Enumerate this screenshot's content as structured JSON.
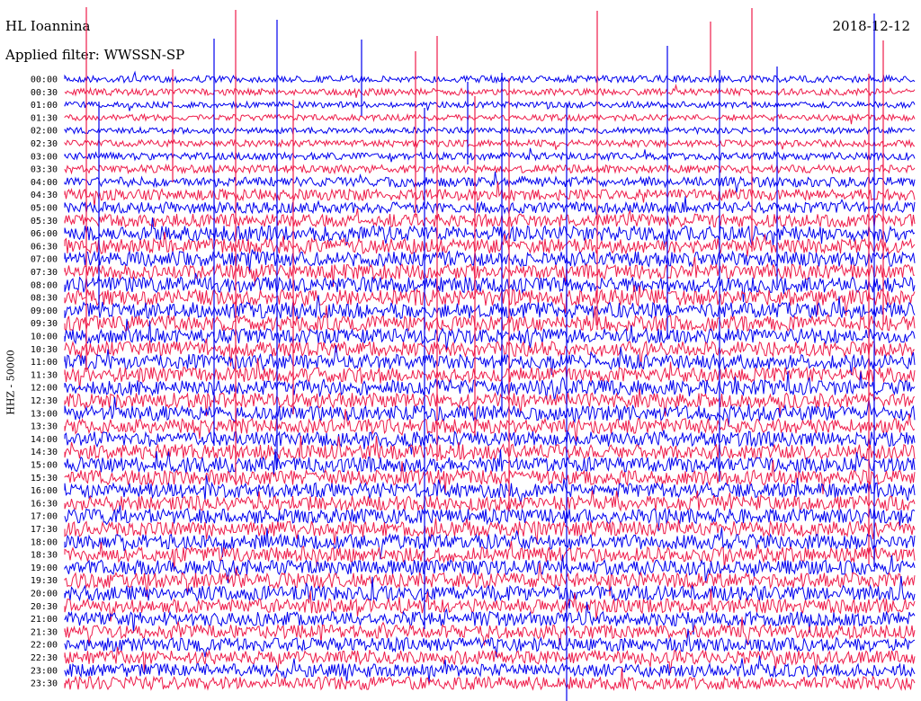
{
  "header": {
    "station": "HL Ioannina",
    "date": "2018-12-12",
    "filter": "Applied filter: WWSSN-SP",
    "channel": "HHZ - 50000"
  },
  "colors": {
    "trace_a": "#0000ee",
    "trace_b": "#ee1c4a",
    "background": "#ffffff"
  },
  "chart_data": {
    "type": "line",
    "title": "HL Ioannina",
    "subtitle": "Applied filter: WWSSN-SP",
    "ylabel": "HHZ - 50000",
    "xlabel": "",
    "grid": false,
    "legend": "none",
    "rows": [
      "00:00",
      "00:30",
      "01:00",
      "01:30",
      "02:00",
      "02:30",
      "03:00",
      "03:30",
      "04:00",
      "04:30",
      "05:00",
      "05:30",
      "06:00",
      "06:30",
      "07:00",
      "07:30",
      "08:00",
      "08:30",
      "09:00",
      "09:30",
      "10:00",
      "10:30",
      "11:00",
      "11:30",
      "12:00",
      "12:30",
      "13:00",
      "13:30",
      "14:00",
      "14:30",
      "15:00",
      "15:30",
      "16:00",
      "16:30",
      "17:00",
      "17:30",
      "18:00",
      "18:30",
      "19:00",
      "19:30",
      "20:00",
      "20:30",
      "21:00",
      "21:30",
      "22:00",
      "22:30",
      "23:00",
      "23:30"
    ],
    "row_colors": [
      "trace_a",
      "trace_b"
    ],
    "relative_noise_level": [
      0.25,
      0.25,
      0.2,
      0.2,
      0.2,
      0.25,
      0.3,
      0.35,
      0.5,
      0.6,
      0.6,
      0.75,
      0.9,
      0.9,
      0.9,
      0.9,
      0.95,
      1.0,
      1.0,
      0.95,
      0.9,
      0.9,
      0.9,
      0.9,
      0.9,
      0.9,
      0.9,
      0.9,
      0.9,
      0.9,
      0.9,
      0.9,
      0.9,
      0.9,
      0.9,
      0.9,
      0.9,
      0.9,
      0.9,
      0.9,
      0.9,
      0.85,
      0.85,
      0.8,
      0.8,
      0.8,
      0.75,
      0.75
    ]
  }
}
